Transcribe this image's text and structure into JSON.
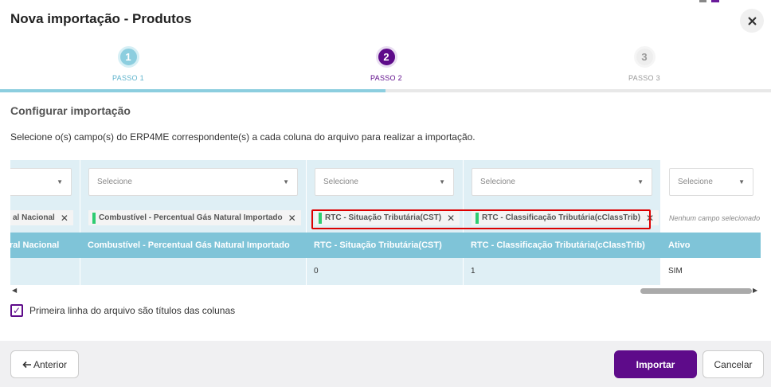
{
  "dialog": {
    "title": "Nova importação - Produtos"
  },
  "stepper": {
    "progress_fraction": 0.5,
    "steps": [
      {
        "number": "1",
        "label": "PASSO 1"
      },
      {
        "number": "2",
        "label": "PASSO 2"
      },
      {
        "number": "3",
        "label": "PASSO 3"
      }
    ]
  },
  "section": {
    "title": "Configurar importação",
    "instructions": "Selecione o(s) campo(s) do ERP4ME correspondente(s) a cada coluna do arquivo para realizar a importação."
  },
  "table": {
    "columns": [
      {
        "select_value": "",
        "tag": "al Nacional",
        "header": "ral Nacional",
        "value": ""
      },
      {
        "select_value": "Selecione",
        "tag": "Combustível - Percentual Gás Natural Importado",
        "header": "Combustível - Percentual Gás Natural Importado",
        "value": ""
      },
      {
        "select_value": "Selecione",
        "tag": "RTC - Situação Tributária(CST)",
        "header": "RTC - Situação Tributária(CST)",
        "value": "0"
      },
      {
        "select_value": "Selecione",
        "tag": "RTC - Classificação Tributária(cClassTrib)",
        "header": "RTC - Classificação Tributária(cClassTrib)",
        "value": "1"
      },
      {
        "select_value": "Selecione",
        "no_field": "Nenhum campo selecionado",
        "header": "Ativo",
        "value": "SIM"
      }
    ]
  },
  "checkbox": {
    "label": "Primeira linha do arquivo são títulos das colunas",
    "checked": true
  },
  "footer": {
    "prev_label": "Anterior",
    "import_label": "Importar",
    "cancel_label": "Cancelar"
  },
  "colors": {
    "primary": "#5e0b8a",
    "step_done": "#8ccedf",
    "header_cell": "#7fc4d8",
    "highlight": "#dd0000",
    "tag_bar": "#2ecc71"
  },
  "icons": {
    "close": "close-icon",
    "caret": "caret-down-icon",
    "remove": "remove-tag-icon",
    "check": "check-icon",
    "arrow_left": "arrow-left-icon"
  }
}
